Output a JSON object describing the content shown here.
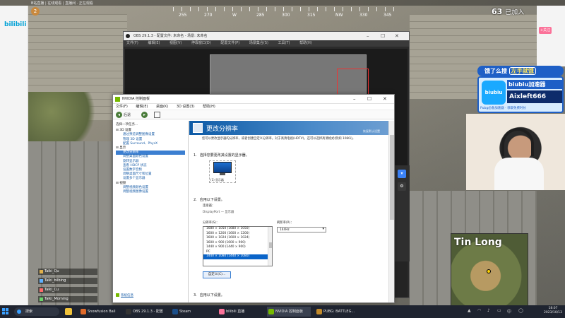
{
  "browser": {
    "url_text": "B站直播 | 在线观看 | 直播间 · 正在观看",
    "bili_logo": "bilibili",
    "follow_btn": "+关注"
  },
  "hud": {
    "alive_count": "63",
    "alive_label": "已加入",
    "player_level": "2",
    "compass": [
      "255",
      "270",
      "W",
      "285",
      "300",
      "315",
      "NW",
      "330",
      "345"
    ]
  },
  "obs": {
    "title": "OBS 29.1.3 - 配置文件: 未命名 - 场景: 未命名",
    "menu": [
      "文件(F)",
      "编辑(E)",
      "视图(V)",
      "停靠窗口(D)",
      "配置文件(P)",
      "场景集合(S)",
      "工具(T)",
      "帮助(H)"
    ]
  },
  "nvidia": {
    "title": "NVIDIA 控制面板",
    "menu": [
      "文件(F)",
      "编辑(E)",
      "桌面(K)",
      "3D 设置(3)",
      "帮助(H)"
    ],
    "toolbar": {
      "back": "后退",
      "forward": ""
    },
    "tree_header": "选择一项任务...",
    "tree": [
      {
        "kind": "g",
        "label": "⊟ 3D 设置"
      },
      {
        "kind": "i",
        "label": "通过预览调整图像设置"
      },
      {
        "kind": "i",
        "label": "管理 3D 设置"
      },
      {
        "kind": "i",
        "label": "配置 Surround、PhysX"
      },
      {
        "kind": "g",
        "label": "⊟ 显示"
      },
      {
        "kind": "i sel",
        "label": "更改分辨率"
      },
      {
        "kind": "i",
        "label": "调整桌面颜色设置"
      },
      {
        "kind": "i",
        "label": "旋转显示器"
      },
      {
        "kind": "i",
        "label": "查看 HDCP 状态"
      },
      {
        "kind": "i",
        "label": "设置数字音频"
      },
      {
        "kind": "i",
        "label": "调整桌面尺寸和位置"
      },
      {
        "kind": "i",
        "label": "设置多个显示器"
      },
      {
        "kind": "g",
        "label": "⊟ 视频"
      },
      {
        "kind": "i",
        "label": "调整视频颜色设置"
      },
      {
        "kind": "i",
        "label": "调整视频图像设置"
      }
    ],
    "system_info": "系统信息",
    "banner_title": "更改分辨率",
    "banner_restore": "恢复默认设置",
    "description": "您可以更改显示器的分辨率，或者创建自定义分辨率。对于高清电视(HDTV)，还可以选择高清格式(例如 1080i)。",
    "step1_num": "1.",
    "step1": "选择您要更改其设置的显示器。",
    "monitor_label": "(1) 显示器",
    "step2_num": "2.",
    "step2": "应用以下设置。",
    "connector_label": "连接器：",
    "connector_value": "DisplayPort — 显示器",
    "resolution_label": "分辨率(S)：",
    "refresh_label": "刷新率(R)：",
    "refresh_value": "144Hz",
    "resolutions": [
      {
        "label": "1680 × 1050 (1680 × 1050)",
        "selected": false
      },
      {
        "label": "1600 × 1200 (1600 × 1200)",
        "selected": false
      },
      {
        "label": "1600 × 1024 (1600 × 1024)",
        "selected": false
      },
      {
        "label": "1600 × 900 (1600 × 900)",
        "selected": false
      },
      {
        "label": "1440 × 900 (1440 × 900)",
        "selected": false
      },
      {
        "label": "PC",
        "selected": false
      },
      {
        "label": "1440 × 1080 (1440 × 1080)",
        "selected": true
      }
    ],
    "custom_button": "自定义(C)...",
    "step3_num": "3.",
    "step3": "应用以下设置。"
  },
  "overlay": {
    "banner_prefix": "饿了么搜",
    "banner_keyword": "左手就饿",
    "brand": "biubiu",
    "promo_title": "biubiu加速器",
    "streamer": "Aixleft666",
    "promo_footer": "Pubg必备加速器 · 领取免费时长",
    "map_location": "Tin Long"
  },
  "team": [
    {
      "name": "Taiki_Qu",
      "color": "#e0b04a"
    },
    {
      "name": "Taiki_bilbing",
      "color": "#5fb0ff"
    },
    {
      "name": "Taiki_Cu",
      "color": "#ff6a6a"
    },
    {
      "name": "Taiki_Morning",
      "color": "#6ad46a"
    }
  ],
  "taskbar": {
    "search": "搜索",
    "apps": [
      {
        "label": "Snowfusion Bali",
        "color": "#e06a2a",
        "active": false
      },
      {
        "label": "OBS 29.1.3 - 配置",
        "color": "#333",
        "active": false
      },
      {
        "label": "Steam",
        "color": "#1b4f8a",
        "active": false
      },
      {
        "label": "bilibili 直播",
        "color": "#fb7299",
        "active": false
      },
      {
        "label": "NVIDIA 控制面板",
        "color": "#76b900",
        "active": true
      },
      {
        "label": "PUBG: BATTLEG...",
        "color": "#c28a2a",
        "active": false
      }
    ],
    "time": "18:07",
    "date": "2023/10/13"
  }
}
